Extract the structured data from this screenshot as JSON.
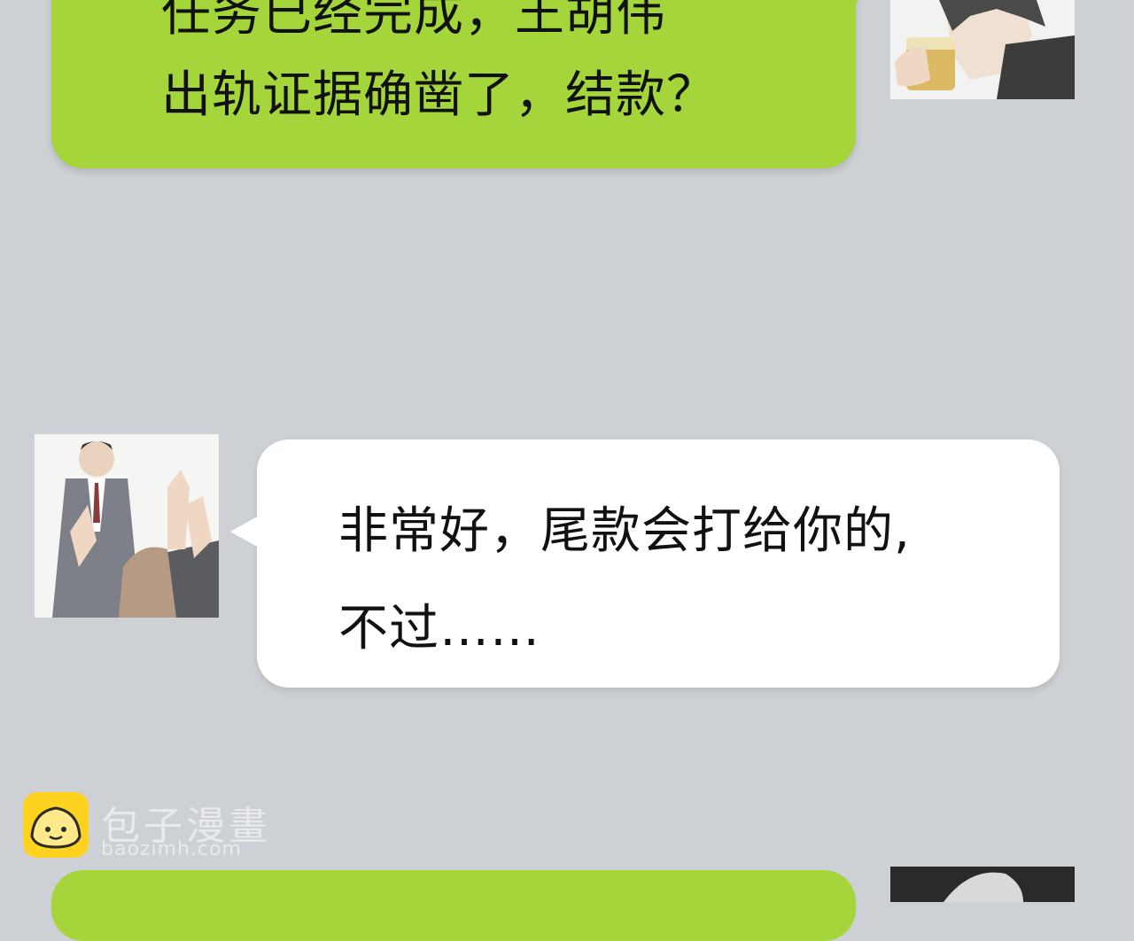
{
  "messages": [
    {
      "id": "sent-1",
      "lines": [
        "任务已经完成，王胡伟",
        "出轨证据确凿了，结款？"
      ]
    },
    {
      "id": "received-1",
      "lines": [
        "非常好，尾款会打给你的,",
        "不过……"
      ]
    }
  ],
  "watermark": {
    "title": "包子漫畫",
    "url": "baozimh.com"
  },
  "colors": {
    "background": "#cdd0d4",
    "sent_bubble": "#a4d53a",
    "received_bubble": "#ffffff",
    "logo": "#ffd21f"
  },
  "icons": [
    "avatar-self",
    "avatar-client",
    "avatar-next",
    "baozi-logo-icon"
  ]
}
